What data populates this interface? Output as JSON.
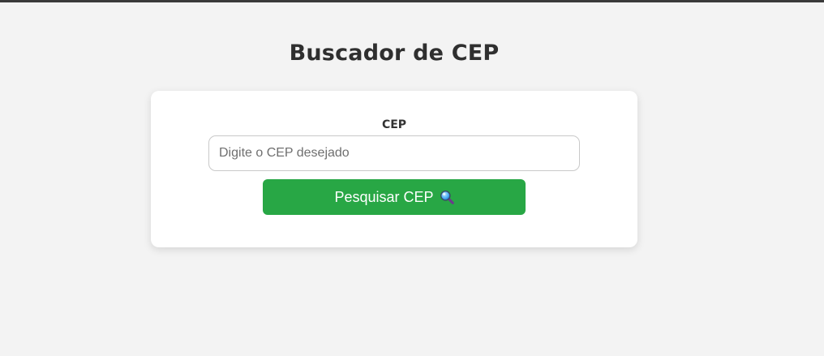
{
  "page": {
    "title": "Buscador de CEP"
  },
  "form": {
    "label": "CEP",
    "input_placeholder": "Digite o CEP desejado",
    "input_value": "",
    "button_label": "Pesquisar CEP",
    "button_icon": "magnifying-glass-icon"
  },
  "colors": {
    "background": "#f3f3f3",
    "card": "#ffffff",
    "button": "#28a745",
    "button_text": "#ffffff",
    "title_text": "#2f2f2f"
  }
}
